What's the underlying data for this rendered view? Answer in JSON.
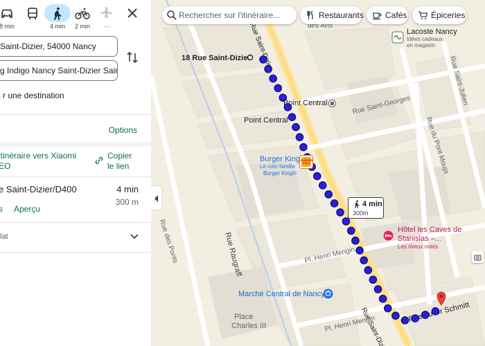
{
  "transport": {
    "modes": [
      {
        "name": "driving",
        "time": "8 min"
      },
      {
        "name": "transit",
        "time": ""
      },
      {
        "name": "walking",
        "time": "4 min"
      },
      {
        "name": "cycling",
        "time": "2 min"
      },
      {
        "name": "flights",
        "time": "—"
      }
    ],
    "selected": "walking"
  },
  "directions": {
    "origin": "Saint-Dizier, 54000 Nancy",
    "destination": "g Indigo Nancy Saint-Dizier Saint-",
    "add_destination": "r une destination",
    "options_label": "Options",
    "send_route": "itinéraire vers Xiaomi",
    "send_route_2": "EO",
    "copy_link": "Copier",
    "copy_link_2": "le lien"
  },
  "route": {
    "via": "e Saint-Dizier/D400",
    "time": "4 min",
    "distance": "300 m",
    "details_label": "s",
    "preview_label": "Aperçu",
    "terrain": "plat"
  },
  "map": {
    "search_placeholder": "Rechercher sur l'itinéraire...",
    "chips": [
      "Restaurants",
      "Cafés",
      "Épiceries"
    ],
    "labels": {
      "origin_address": "18 Rue Saint-Dizier",
      "point_central_1": "Point Central",
      "point_central_2": "Point Central",
      "burger_king": "Burger King",
      "burger_king_sub1": "Le coin famille",
      "burger_king_sub2": "Burger King®",
      "lacoste": "Lacoste Nancy",
      "lacoste_sub1": "Idées cadeaux",
      "lacoste_sub2": "en magasin",
      "des_arts": "des Arts",
      "hotel": "Hôtel les Caves de",
      "hotel_2": "Stanislas –...",
      "hotel_sub": "Les mieux notés",
      "marche": "Marché Central de Nancy",
      "place": "Place",
      "place_2": "Charles III",
      "burger_king_logo": "BURGER KING"
    },
    "streets": {
      "rue_saint_dizier_top": "Rue Saint-Dizier",
      "rue_saint_dizier_bottom": "Rue Saint-Dizier",
      "rue_saint_georges": "Rue Saint-Georges",
      "rue_du_pont_mouja": "Rue du Pont Mouja",
      "rue_saint_julien": "Rue Saint-Julien",
      "rue_des_ponts": "Rue des Ponts",
      "rue_raugraff": "Rue Raugraff",
      "pl_henri_mengin_1": "Pl. Henri Mengin",
      "pl_henri_mengin_2": "Pl. Henri Mengin",
      "rue_du_dr_schmitt": "Rue du Dr Schmitt"
    },
    "walk_badge": {
      "time": "4 min",
      "distance": "300m"
    },
    "route_color": "#1a0dab"
  }
}
